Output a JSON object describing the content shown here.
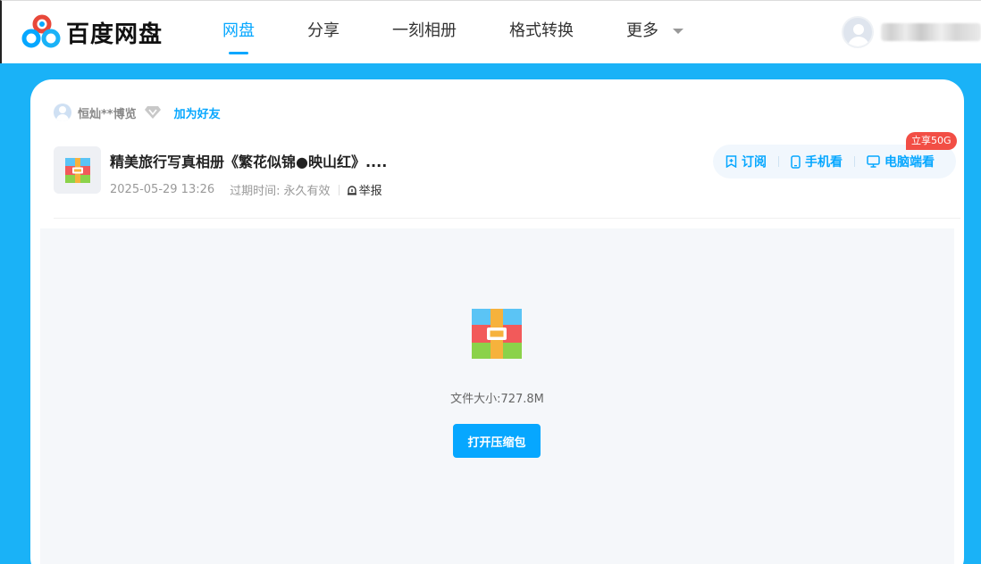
{
  "brand": {
    "name": "百度网盘"
  },
  "nav": {
    "items": [
      {
        "label": "网盘",
        "active": true
      },
      {
        "label": "分享",
        "active": false
      },
      {
        "label": "一刻相册",
        "active": false
      },
      {
        "label": "格式转换",
        "active": false
      },
      {
        "label": "更多",
        "active": false,
        "has_dropdown": true
      }
    ]
  },
  "user": {
    "avatar_icon": "default-avatar-icon"
  },
  "share": {
    "sharer_name": "恒灿**博览",
    "vip_icon": "diamond-vip-icon",
    "add_friend_label": "加为好友",
    "file_title": "精美旅行写真相册《繁花似锦●映山红》....",
    "date": "2025-05-29 13:26",
    "expire_label": "过期时间:",
    "expire_value": "永久有效",
    "report_label": "举报"
  },
  "actions": {
    "subscribe_label": "订阅",
    "phone_label": "手机看",
    "pc_label": "电脑端看",
    "promo_badge": "立享50G"
  },
  "preview": {
    "file_icon": "zip-archive-icon",
    "file_size_text": "文件大小:727.8M",
    "open_button_label": "打开压缩包"
  },
  "colors": {
    "accent": "#06a7ff",
    "page_bg": "#1ab2f7",
    "promo": "#f24e45"
  }
}
